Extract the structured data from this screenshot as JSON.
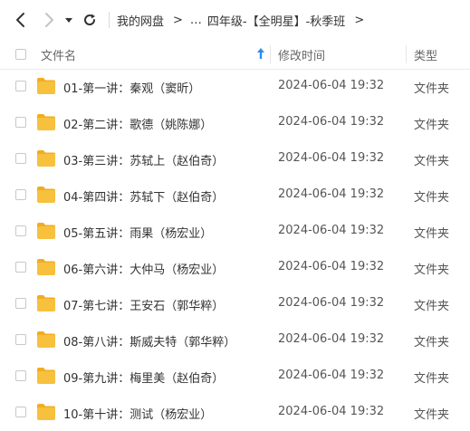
{
  "breadcrumb": {
    "root": "我的网盘",
    "ellipsis": "…",
    "current": "四年级-【全明星】-秋季班",
    "separator": ">"
  },
  "columns": {
    "name": "文件名",
    "mtime": "修改时间",
    "type": "类型"
  },
  "rows": [
    {
      "name": "01-第一讲：秦观（窦昕）",
      "mtime": "2024-06-04 19:32",
      "type": "文件夹"
    },
    {
      "name": "02-第二讲：歌德（姚陈娜）",
      "mtime": "2024-06-04 19:32",
      "type": "文件夹"
    },
    {
      "name": "03-第三讲：苏轼上（赵伯奇）",
      "mtime": "2024-06-04 19:32",
      "type": "文件夹"
    },
    {
      "name": "04-第四讲：苏轼下（赵伯奇）",
      "mtime": "2024-06-04 19:32",
      "type": "文件夹"
    },
    {
      "name": "05-第五讲：雨果（杨宏业）",
      "mtime": "2024-06-04 19:32",
      "type": "文件夹"
    },
    {
      "name": "06-第六讲：大仲马（杨宏业）",
      "mtime": "2024-06-04 19:32",
      "type": "文件夹"
    },
    {
      "name": "07-第七讲：王安石（郭华粹）",
      "mtime": "2024-06-04 19:32",
      "type": "文件夹"
    },
    {
      "name": "08-第八讲：斯威夫特（郭华粹）",
      "mtime": "2024-06-04 19:32",
      "type": "文件夹"
    },
    {
      "name": "09-第九讲：梅里美（赵伯奇）",
      "mtime": "2024-06-04 19:32",
      "type": "文件夹"
    },
    {
      "name": "10-第十讲：测试（杨宏业）",
      "mtime": "2024-06-04 19:32",
      "type": "文件夹"
    }
  ],
  "colors": {
    "folder": "#f7c13e",
    "folder_tab": "#f2ac1f",
    "sort_arrow": "#2b8cf0",
    "disabled": "#c4c4c4"
  }
}
